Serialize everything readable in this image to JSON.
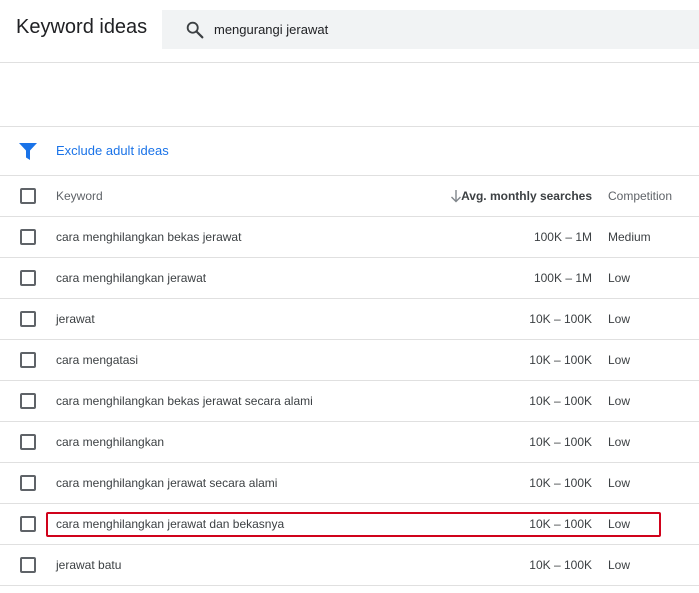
{
  "header": {
    "title": "Keyword ideas",
    "search_value": "mengurangi jerawat"
  },
  "filter": {
    "label": "Exclude adult ideas"
  },
  "table": {
    "columns": {
      "keyword": "Keyword",
      "searches": "Avg. monthly searches",
      "competition": "Competition"
    },
    "rows": [
      {
        "keyword": "cara menghilangkan bekas jerawat",
        "searches": "100K – 1M",
        "competition": "Medium"
      },
      {
        "keyword": "cara menghilangkan jerawat",
        "searches": "100K – 1M",
        "competition": "Low"
      },
      {
        "keyword": "jerawat",
        "searches": "10K – 100K",
        "competition": "Low"
      },
      {
        "keyword": "cara mengatasi",
        "searches": "10K – 100K",
        "competition": "Low"
      },
      {
        "keyword": "cara menghilangkan bekas jerawat secara alami",
        "searches": "10K – 100K",
        "competition": "Low"
      },
      {
        "keyword": "cara menghilangkan",
        "searches": "10K – 100K",
        "competition": "Low"
      },
      {
        "keyword": "cara menghilangkan jerawat secara alami",
        "searches": "10K – 100K",
        "competition": "Low"
      },
      {
        "keyword": "cara menghilangkan jerawat dan bekasnya",
        "searches": "10K – 100K",
        "competition": "Low"
      },
      {
        "keyword": "jerawat batu",
        "searches": "10K – 100K",
        "competition": "Low"
      }
    ]
  },
  "icons": {
    "search": "search-icon",
    "filter": "filter-icon",
    "sort": "arrow-down-icon"
  },
  "colors": {
    "accent": "#1a73e8",
    "highlight": "#d0021b",
    "search_bg": "#f1f3f4"
  }
}
